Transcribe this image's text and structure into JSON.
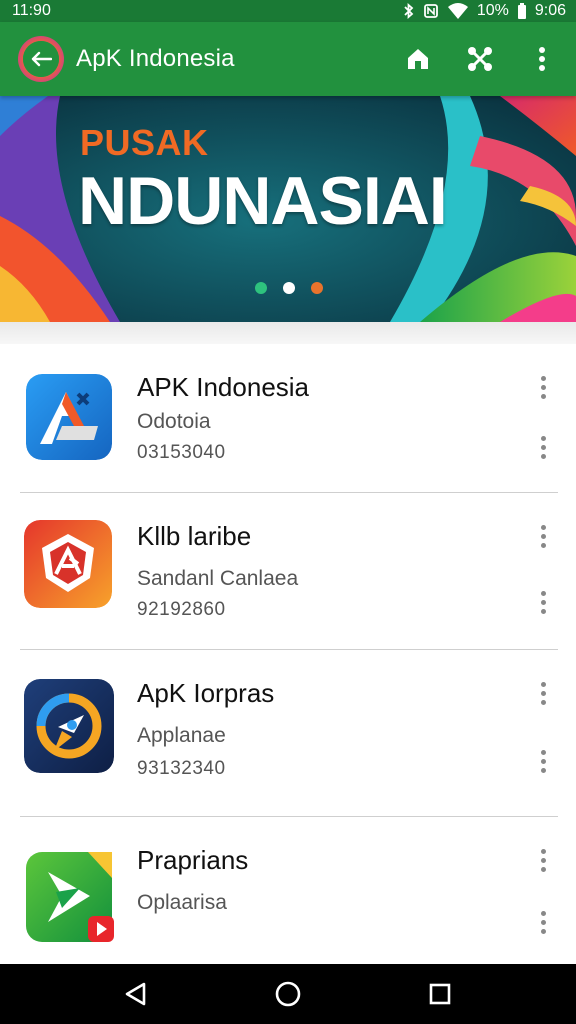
{
  "status_bar": {
    "left_time": "11:90",
    "battery_text": "10%",
    "clock": "9:06"
  },
  "app_bar": {
    "title": "ApK Indonesia",
    "icons": [
      "back-arrow-icon",
      "house-icon",
      "share-icon",
      "overflow-menu-icon"
    ]
  },
  "banner": {
    "kicker": "PUSAK",
    "title": "NDUNASIAI",
    "dot_colors": [
      "#2ec27e",
      "#ffffff",
      "#e8732c"
    ],
    "active_dot": 1
  },
  "apps": [
    {
      "name": "APK Indonesia",
      "subtitle": "Odotoia",
      "number": "03153040",
      "icon": "apk-a-icon"
    },
    {
      "name": "Kllb laribe",
      "subtitle": "Sandanl Canlaea",
      "number": "92192860",
      "icon": "red-shield-icon"
    },
    {
      "name": "ApK Iorpras",
      "subtitle": "Applanae",
      "number": "93132340",
      "icon": "blue-orbit-icon"
    },
    {
      "name": "Praprians",
      "subtitle": "Oplaarisa",
      "number": "",
      "icon": "green-play-icon"
    }
  ],
  "colors": {
    "status_bar": "#1a7a35",
    "app_bar": "#22913e",
    "banner_kicker": "#f06a24"
  },
  "nav_bar": {
    "icons": [
      "back-triangle-icon",
      "home-circle-icon",
      "recents-square-icon"
    ]
  }
}
